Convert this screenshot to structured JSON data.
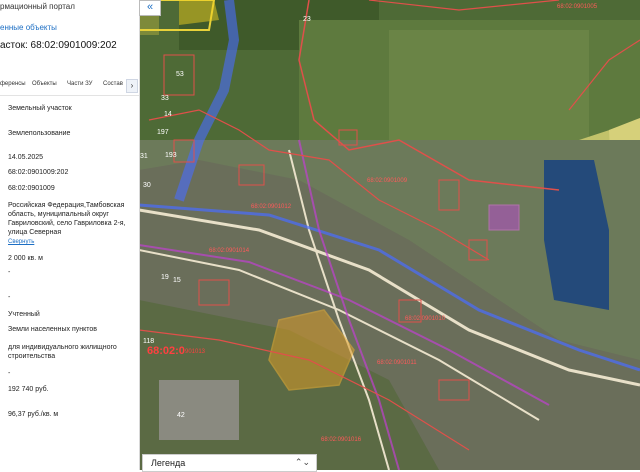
{
  "panel": {
    "portal_title": "рмационный портал",
    "selected_link": "енные объекты",
    "parcel_title": "асток: 68:02:0901009:202",
    "tabs": [
      "ференсы",
      "Объекты",
      "Части ЗУ",
      "Состав"
    ],
    "tab_more": "›",
    "fields": {
      "object_type": "Земельный участок",
      "category_kind": "Землепользование",
      "date": "14.05.2025",
      "cadastral_number": "68:02:0901009:202",
      "quarter": "68:02:0901009",
      "address": "Российская Федерация,Тамбовская область, муниципальный округ Гавриловский, село Гавриловка 2-я, улица Северная",
      "address_link": "Свернуть",
      "area": "2 000 кв. м",
      "dash1": "-",
      "dash2": "-",
      "status": "Учтенный",
      "land_category": "Земли населенных пунктов",
      "permitted_use": "для индивидуального жилищного строительства",
      "dash3": "-",
      "cadastral_value": "192 740 руб.",
      "specific_value": "96,37 руб./кв. м"
    }
  },
  "map": {
    "collapse_icon": "«",
    "labels": {
      "q_top_right": "68:02:0901005",
      "q_center": "68:02:0901009",
      "q_left1": "68:02:0901012",
      "q_left2": "68:02:0901014",
      "q_mid": "68:02:0901010",
      "q_lower": "68:02:0901011",
      "q_bottom": "68:02:0901016",
      "q_bold": "68:02:0",
      "q_bold_small": "901013",
      "n53": "53",
      "n23": "23",
      "n33": "33",
      "n14": "14",
      "n197": "197",
      "n193": "193",
      "n31": "31",
      "n30": "30",
      "n15": "15",
      "n19": "19",
      "n118": "118",
      "n42": "42"
    }
  },
  "legend": {
    "label": "Легенда",
    "icon": "chevron-updown-icon"
  },
  "colors": {
    "accent": "#1d6fc4",
    "quarter_line": "#e0504a",
    "zone_blue": "#4a6cff",
    "zone_purple": "#c040d0"
  }
}
